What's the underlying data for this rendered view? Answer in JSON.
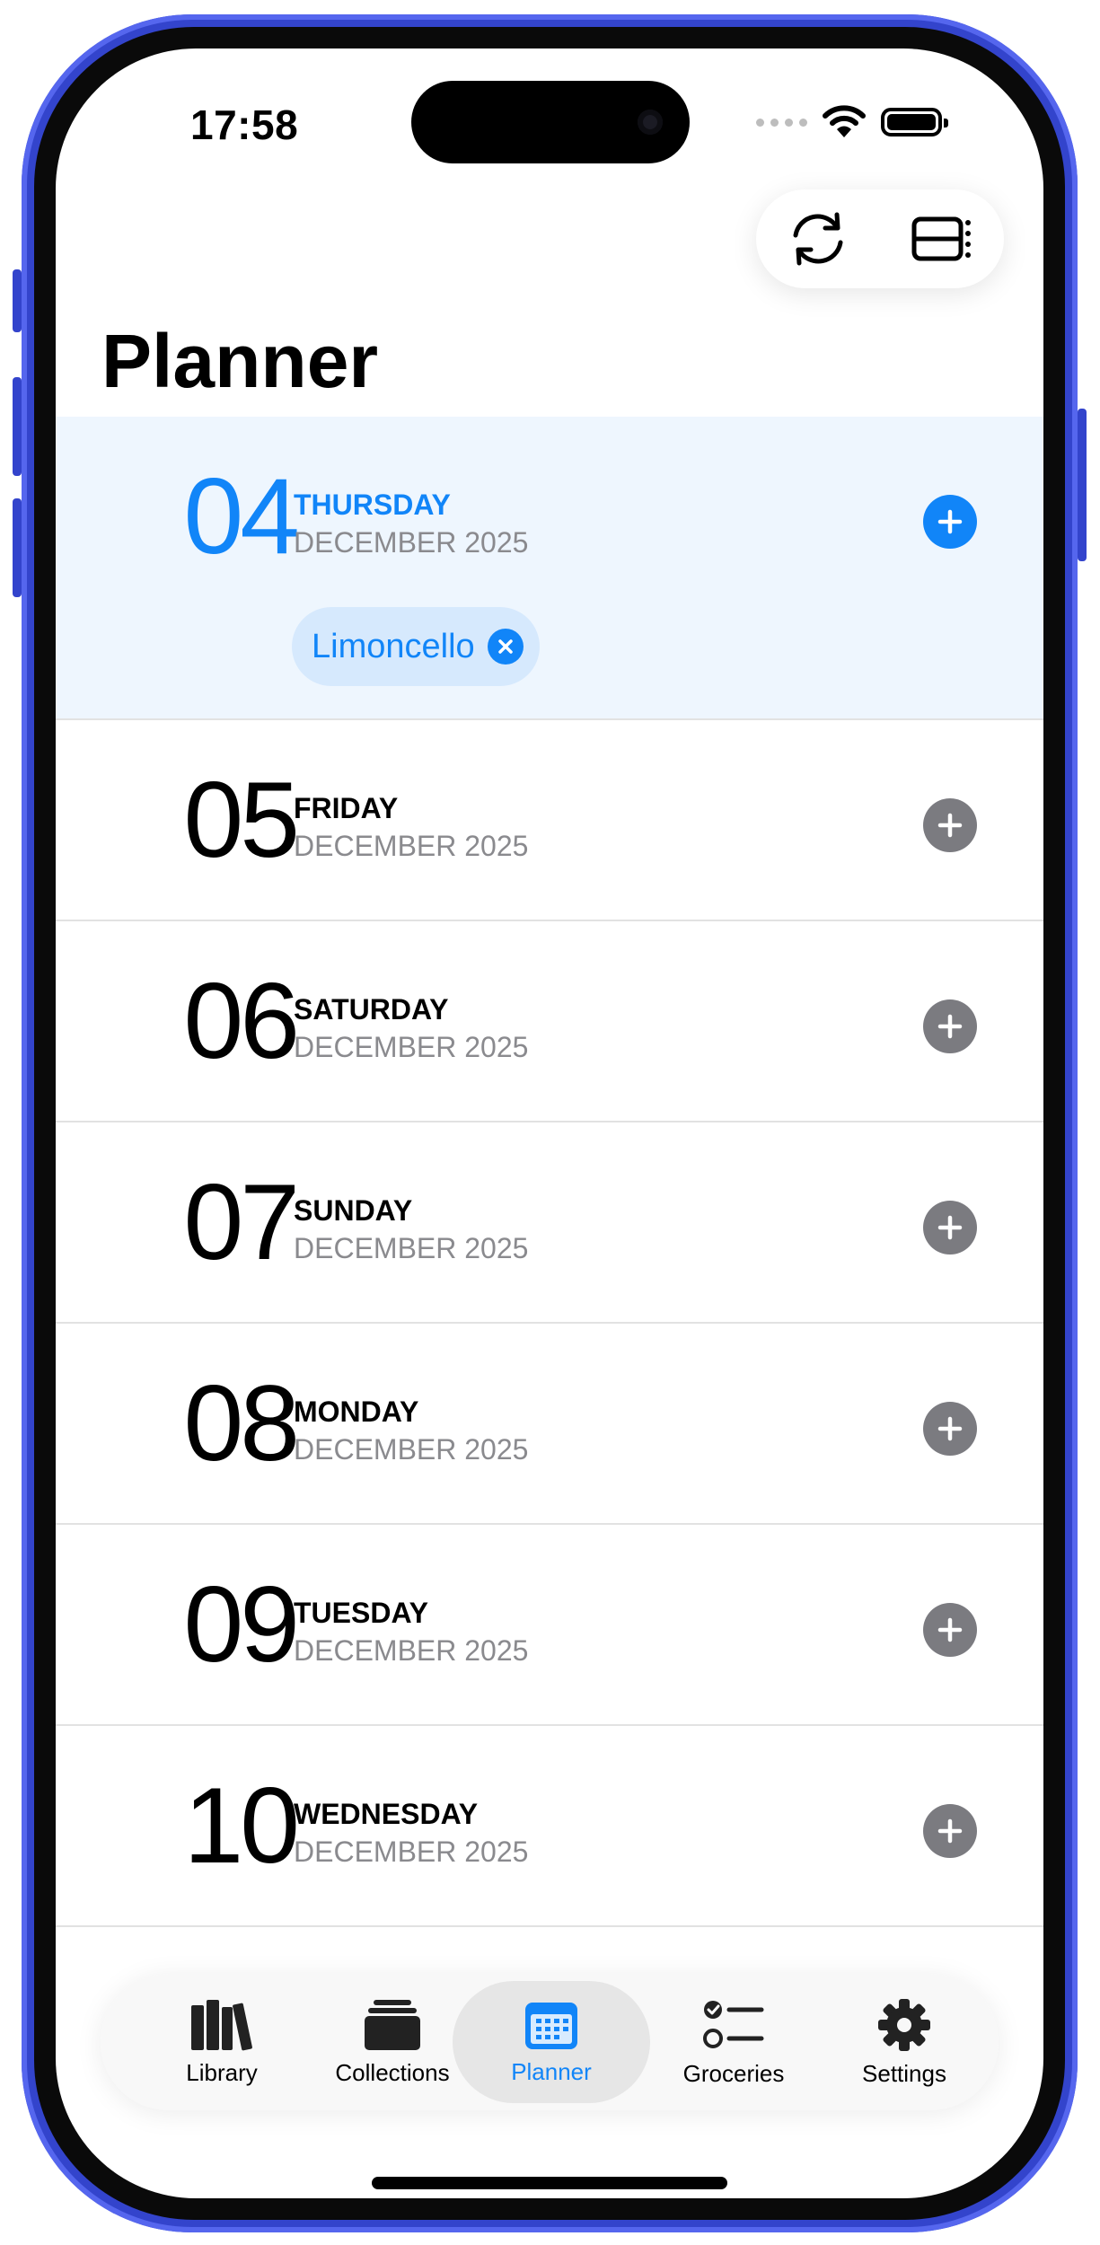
{
  "status_bar": {
    "time": "17:58"
  },
  "header": {
    "title": "Planner"
  },
  "days": [
    {
      "day": "04",
      "weekday": "THURSDAY",
      "month": "DECEMBER 2025",
      "selected": true,
      "meals": [
        "Limoncello"
      ]
    },
    {
      "day": "05",
      "weekday": "FRIDAY",
      "month": "DECEMBER 2025"
    },
    {
      "day": "06",
      "weekday": "SATURDAY",
      "month": "DECEMBER 2025"
    },
    {
      "day": "07",
      "weekday": "SUNDAY",
      "month": "DECEMBER 2025"
    },
    {
      "day": "08",
      "weekday": "MONDAY",
      "month": "DECEMBER 2025"
    },
    {
      "day": "09",
      "weekday": "TUESDAY",
      "month": "DECEMBER 2025"
    },
    {
      "day": "10",
      "weekday": "WEDNESDAY",
      "month": "DECEMBER 2025"
    }
  ],
  "tabs": [
    {
      "label": "Library",
      "icon": "books-icon"
    },
    {
      "label": "Collections",
      "icon": "collections-icon"
    },
    {
      "label": "Planner",
      "icon": "calendar-icon",
      "active": true
    },
    {
      "label": "Groceries",
      "icon": "checklist-icon"
    },
    {
      "label": "Settings",
      "icon": "gear-icon"
    }
  ],
  "colors": {
    "accent": "#1185f8",
    "selected_row": "#eef6fe",
    "add_button": "#7b7b80",
    "frame": "#3344cc"
  }
}
